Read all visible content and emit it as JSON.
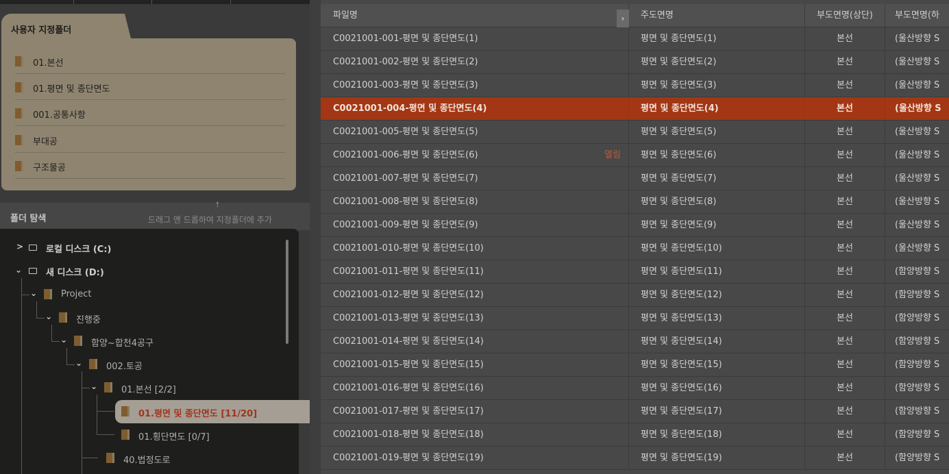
{
  "user_folders": {
    "title": "사용자 지정폴더",
    "items": [
      "01.본선",
      "01.평면 및 종단면도",
      "001.공통사항",
      "부대공",
      "구조물공"
    ]
  },
  "folder_search": {
    "title": "폴더 탐색",
    "hint": "드래그 앤 드롭하여 지정폴더에 추가",
    "hint_arrow": "🠕",
    "tree": {
      "disk_c": "로컬 디스크 (C:)",
      "disk_d": "새 디스크 (D:)",
      "project": "Project",
      "in_progress": "진행중",
      "hamyang": "함양~합천4공구",
      "earthwork": "002.토공",
      "mainline": "01.본선 [2/2]",
      "plan_profile": "01.평면 및 종단면도 [11/20]",
      "cross_section": "01.횡단면도 [0/7]",
      "road": "40.법정도로"
    }
  },
  "table": {
    "columns": [
      "파일명",
      "주도면명",
      "부도면명(상단)",
      "부도면명(하"
    ],
    "sort_glyph": "›",
    "open_label": "열림",
    "rows": [
      {
        "file": "C0021001-001-평면 및 종단면도(1)",
        "main": "평면 및 종단면도(1)",
        "sub": "본선",
        "sub2": "(울산방향 S"
      },
      {
        "file": "C0021001-002-평면 및 종단면도(2)",
        "main": "평면 및 종단면도(2)",
        "sub": "본선",
        "sub2": "(울산방향 S"
      },
      {
        "file": "C0021001-003-평면 및 종단면도(3)",
        "main": "평면 및 종단면도(3)",
        "sub": "본선",
        "sub2": "(울산방향 S"
      },
      {
        "file": "C0021001-004-평면 및 종단면도(4)",
        "main": "평면 및 종단면도(4)",
        "sub": "본선",
        "sub2": "(울산방향 S"
      },
      {
        "file": "C0021001-005-평면 및 종단면도(5)",
        "main": "평면 및 종단면도(5)",
        "sub": "본선",
        "sub2": "(울산방향 S"
      },
      {
        "file": "C0021001-006-평면 및 종단면도(6)",
        "main": "평면 및 종단면도(6)",
        "sub": "본선",
        "sub2": "(울산방향 S"
      },
      {
        "file": "C0021001-007-평면 및 종단면도(7)",
        "main": "평면 및 종단면도(7)",
        "sub": "본선",
        "sub2": "(울산방향 S"
      },
      {
        "file": "C0021001-008-평면 및 종단면도(8)",
        "main": "평면 및 종단면도(8)",
        "sub": "본선",
        "sub2": "(울산방향 S"
      },
      {
        "file": "C0021001-009-평면 및 종단면도(9)",
        "main": "평면 및 종단면도(9)",
        "sub": "본선",
        "sub2": "(울산방향 S"
      },
      {
        "file": "C0021001-010-평면 및 종단면도(10)",
        "main": "평면 및 종단면도(10)",
        "sub": "본선",
        "sub2": "(울산방향 S"
      },
      {
        "file": "C0021001-011-평면 및 종단면도(11)",
        "main": "평면 및 종단면도(11)",
        "sub": "본선",
        "sub2": "(함양방향 S"
      },
      {
        "file": "C0021001-012-평면 및 종단면도(12)",
        "main": "평면 및 종단면도(12)",
        "sub": "본선",
        "sub2": "(함양방향 S"
      },
      {
        "file": "C0021001-013-평면 및 종단면도(13)",
        "main": "평면 및 종단면도(13)",
        "sub": "본선",
        "sub2": "(함양방향 S"
      },
      {
        "file": "C0021001-014-평면 및 종단면도(14)",
        "main": "평면 및 종단면도(14)",
        "sub": "본선",
        "sub2": "(함양방향 S"
      },
      {
        "file": "C0021001-015-평면 및 종단면도(15)",
        "main": "평면 및 종단면도(15)",
        "sub": "본선",
        "sub2": "(함양방향 S"
      },
      {
        "file": "C0021001-016-평면 및 종단면도(16)",
        "main": "평면 및 종단면도(16)",
        "sub": "본선",
        "sub2": "(함양방향 S"
      },
      {
        "file": "C0021001-017-평면 및 종단면도(17)",
        "main": "평면 및 종단면도(17)",
        "sub": "본선",
        "sub2": "(함양방향 S"
      },
      {
        "file": "C0021001-018-평면 및 종단면도(18)",
        "main": "평면 및 종단면도(18)",
        "sub": "본선",
        "sub2": "(함양방향 S"
      },
      {
        "file": "C0021001-019-평면 및 종단면도(19)",
        "main": "평면 및 종단면도(19)",
        "sub": "본선",
        "sub2": "(함양방향 S"
      }
    ]
  }
}
